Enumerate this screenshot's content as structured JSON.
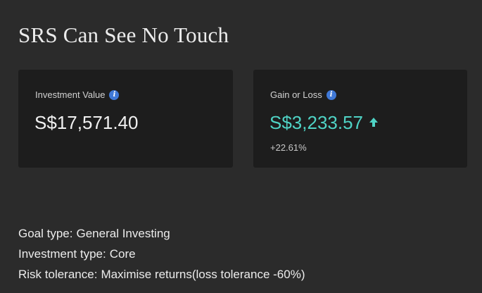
{
  "page": {
    "title": "SRS Can See No Touch"
  },
  "investment_card": {
    "label": "Investment Value",
    "value": "S$17,571.40",
    "info_icon": "info-icon"
  },
  "gain_card": {
    "label": "Gain or Loss",
    "value": "S$3,233.57",
    "change_percent": "+22.61%",
    "info_icon": "info-icon",
    "trend_icon": "arrow-up-icon",
    "color": "#4fd3c5"
  },
  "details": {
    "goal_type_label": "Goal type:",
    "goal_type_value": "General Investing",
    "investment_type_label": "Investment type:",
    "investment_type_value": "Core",
    "risk_tolerance_label": "Risk tolerance:",
    "risk_tolerance_value": "Maximise returns(loss tolerance -60%)"
  },
  "colors": {
    "background": "#2b2b2b",
    "card": "#1d1d1d",
    "accent": "#4fd3c5",
    "info_icon": "#3f78d6"
  }
}
